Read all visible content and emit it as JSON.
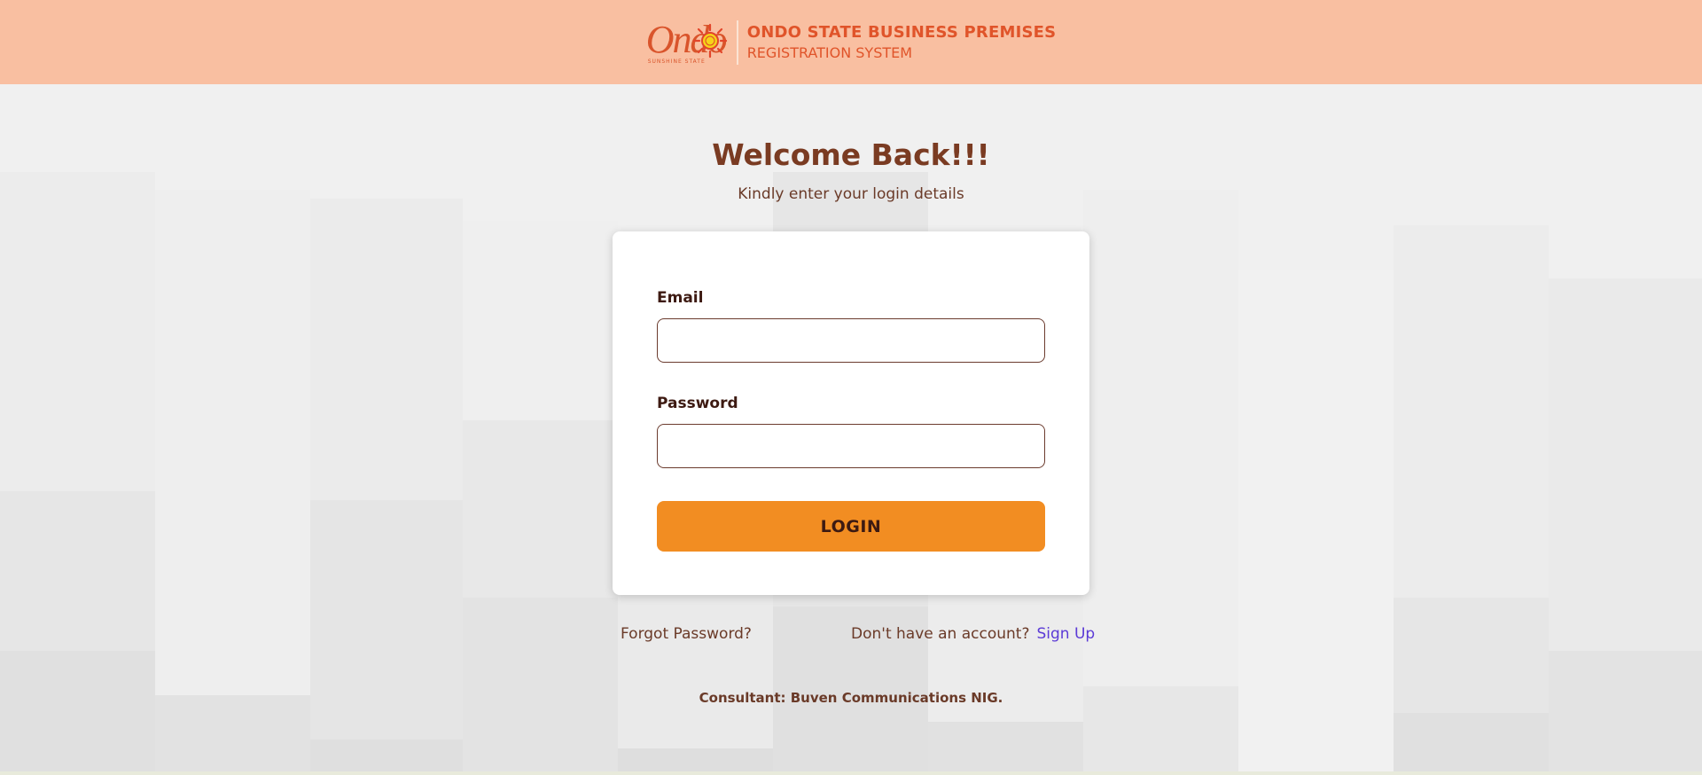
{
  "header": {
    "logo_word": "Ondo",
    "logo_tagline": "SUNSHINE STATE",
    "title_line1": "ONDO STATE BUSINESS PREMISES",
    "title_line2": "REGISTRATION SYSTEM"
  },
  "login": {
    "title": "Welcome Back!!!",
    "subtitle": "Kindly enter your login details",
    "email_label": "Email",
    "email_value": "",
    "email_placeholder": "",
    "password_label": "Password",
    "password_value": "",
    "password_placeholder": "",
    "login_button": "LOGIN"
  },
  "links": {
    "forgot_password": "Forgot Password?",
    "no_account": "Don't have an account?",
    "sign_up": "Sign Up"
  },
  "footer": {
    "consultant": "Consultant: Buven Communications NIG."
  },
  "colors": {
    "header_bg": "#f9bfa1",
    "brand": "#e0542a",
    "heading": "#7a3b22",
    "button": "#f28d22",
    "link": "#5b3ad6"
  }
}
